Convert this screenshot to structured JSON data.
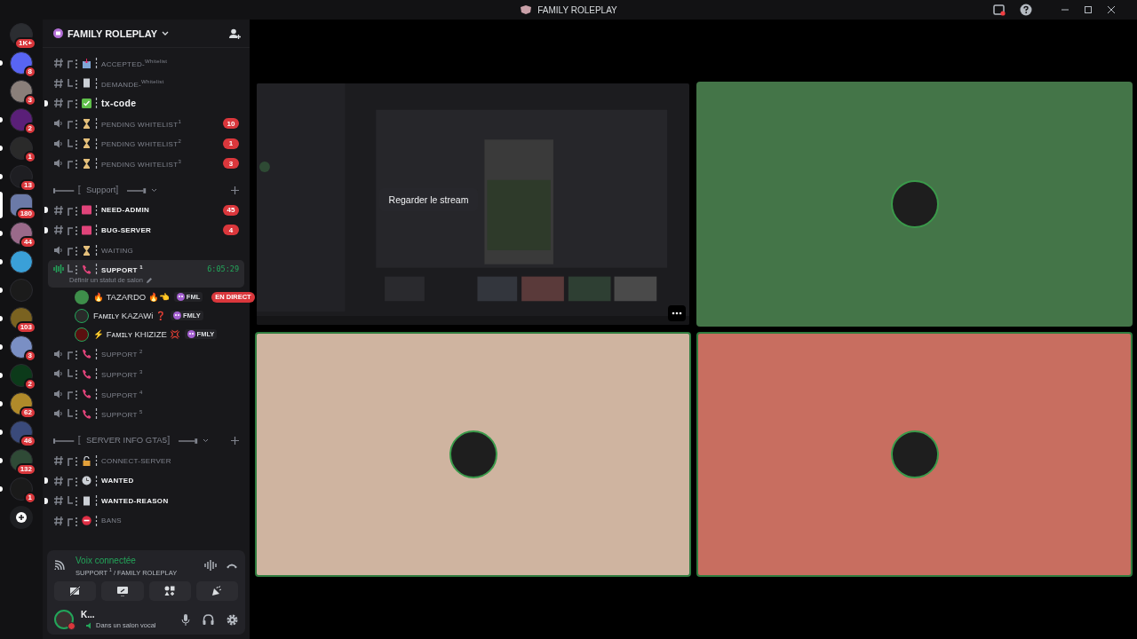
{
  "window": {
    "title": "FAMILY ROLEPLAY"
  },
  "servers": [
    {
      "badge": "1K+",
      "unread": false,
      "selected": false,
      "color": "#2b2d31"
    },
    {
      "badge": "8",
      "unread": true,
      "selected": false,
      "color": "#5865f2"
    },
    {
      "badge": "3",
      "unread": false,
      "selected": false,
      "color": "#8a7f7a"
    },
    {
      "badge": "2",
      "unread": true,
      "selected": false,
      "color": "#5a1f78"
    },
    {
      "badge": "1",
      "unread": true,
      "selected": false,
      "color": "#2a2a2a"
    },
    {
      "badge": "13",
      "unread": true,
      "selected": false,
      "color": "#1e1e22"
    },
    {
      "badge": "180",
      "unread": false,
      "selected": true,
      "color": "#6b7aa8"
    },
    {
      "badge": "44",
      "unread": true,
      "selected": false,
      "color": "#9a6a8a"
    },
    {
      "unread": true,
      "selected": false,
      "color": "#3aa0d8"
    },
    {
      "unread": true,
      "selected": false,
      "color": "#1b1b1b"
    },
    {
      "badge": "103",
      "unread": true,
      "selected": false,
      "color": "#7a6220"
    },
    {
      "badge": "3",
      "unread": true,
      "selected": false,
      "color": "#7a8fc4"
    },
    {
      "badge": "2",
      "unread": true,
      "selected": false,
      "color": "#0c3a1a"
    },
    {
      "badge": "62",
      "unread": true,
      "selected": false,
      "color": "#b08a2a"
    },
    {
      "badge": "46",
      "unread": true,
      "selected": false,
      "color": "#3a4a7a"
    },
    {
      "badge": "132",
      "unread": true,
      "selected": false,
      "color": "#2f4a36"
    },
    {
      "badge": "1",
      "unread": true,
      "selected": false,
      "color": "#1a1a1a"
    }
  ],
  "guild": {
    "name": "FAMILY ROLEPLAY"
  },
  "channels": [
    {
      "kind": "text",
      "corner": {
        "kind": "top"
      },
      "emoji": {
        "kind": "inbox"
      },
      "name": "ACCEPTED-$^{Whitelist}$",
      "unread": false,
      "selected": false
    },
    {
      "kind": "text",
      "corner": {
        "kind": "bottom"
      },
      "emoji": {
        "kind": "page"
      },
      "name": "DEMANDE-$^{Whitelist}$",
      "unread": false,
      "selected": false
    },
    {
      "kind": "text",
      "corner": {
        "kind": "top"
      },
      "emoji": {
        "kind": "check"
      },
      "name": "tx-code",
      "unread": true,
      "selected": false
    },
    {
      "kind": "voice",
      "corner": {
        "kind": "top"
      },
      "emoji": {
        "kind": "hourglass"
      },
      "name": "PENDING WHITELIST$^{1}$",
      "badge": "10",
      "unread": false,
      "selected": false
    },
    {
      "kind": "voice",
      "corner": {
        "kind": "bottom"
      },
      "emoji": {
        "kind": "hourglass"
      },
      "name": "PENDING WHITELIST$^{2}$",
      "badge": "1",
      "unread": false,
      "selected": false
    },
    {
      "kind": "voice",
      "corner": {
        "kind": "top"
      },
      "emoji": {
        "kind": "hourglass"
      },
      "name": "PENDING WHITELIST$^{3}$",
      "badge": "3",
      "unread": false,
      "selected": false
    },
    {
      "kind": "category",
      "name": "〚Support〛"
    },
    {
      "kind": "text",
      "corner": {
        "kind": "top"
      },
      "emoji": {
        "kind": "sos"
      },
      "name": "NEED-ADMIN",
      "badge": "45",
      "unread": true,
      "selected": false
    },
    {
      "kind": "text",
      "corner": {
        "kind": "top"
      },
      "emoji": {
        "kind": "sos"
      },
      "name": "BUG-SERVER",
      "badge": "4",
      "unread": true,
      "selected": false
    },
    {
      "kind": "voice",
      "corner": {
        "kind": "top"
      },
      "emoji": {
        "kind": "hourglass"
      },
      "name": "WAITING",
      "unread": false,
      "selected": false
    },
    {
      "kind": "voice",
      "corner": {
        "kind": "bottom"
      },
      "emoji": {
        "kind": "phone"
      },
      "name": "SUPPORT $^{1}$",
      "unread": false,
      "selected": true,
      "timer": "6:05:29",
      "status": "Définir un statut de salon",
      "members": [
        {
          "name": "🔥 TAZARDO 🔥👈",
          "tag": "FML",
          "live": "EN DIRECT",
          "speaking": false,
          "color": "#3e8e4a"
        },
        {
          "name": "Fᴀᴍɪʟʏ KAZAWi ❓",
          "tag": "FMLY",
          "speaking": true,
          "color": "#2a2a2a"
        },
        {
          "name": "⚡ Fᴀᴍɪʟʏ KHIZIZE 💢",
          "tag": "FMLY",
          "speaking": true,
          "color": "#5a1010"
        }
      ]
    },
    {
      "kind": "voice",
      "corner": {
        "kind": "top"
      },
      "emoji": {
        "kind": "phone"
      },
      "name": "SUPPORT $^{2}$",
      "unread": false,
      "selected": false
    },
    {
      "kind": "voice",
      "corner": {
        "kind": "bottom"
      },
      "emoji": {
        "kind": "phone"
      },
      "name": "SUPPORT $^{3}$",
      "unread": false,
      "selected": false
    },
    {
      "kind": "voice",
      "corner": {
        "kind": "top"
      },
      "emoji": {
        "kind": "phone"
      },
      "name": "SUPPORT $^{4}$",
      "unread": false,
      "selected": false
    },
    {
      "kind": "voice",
      "corner": {
        "kind": "bottom"
      },
      "emoji": {
        "kind": "phone"
      },
      "name": "SUPPORT $^{5}$",
      "unread": false,
      "selected": false
    },
    {
      "kind": "category",
      "name": "〚SERVER INFO GTA5〛"
    },
    {
      "kind": "text",
      "corner": {
        "kind": "top"
      },
      "emoji": {
        "kind": "lock"
      },
      "name": "CONNECT-SERVER",
      "unread": false,
      "selected": false
    },
    {
      "kind": "text",
      "corner": {
        "kind": "top"
      },
      "emoji": {
        "kind": "clock"
      },
      "name": "WANTED",
      "unread": true,
      "selected": false
    },
    {
      "kind": "text",
      "corner": {
        "kind": "bottom"
      },
      "emoji": {
        "kind": "page"
      },
      "name": "WANTED-REASON",
      "unread": true,
      "selected": false
    },
    {
      "kind": "text",
      "corner": {
        "kind": "top"
      },
      "emoji": {
        "kind": "no-entry"
      },
      "name": "BANS",
      "unread": false,
      "selected": false
    }
  ],
  "voice_panel": {
    "status": "Voix connectée",
    "location": "SUPPORT $^{1}$ / FAMILY ROLEPLAY"
  },
  "user": {
    "name": "K...",
    "status": "Dans un salon vocal"
  },
  "tiles": [
    {
      "kind": "stream",
      "button": "Regarder le stream",
      "speaking": false
    },
    {
      "kind": "avatar",
      "color": "#447548",
      "speaking": false
    },
    {
      "kind": "avatar",
      "color": "#cfb4a0",
      "speaking": true
    },
    {
      "kind": "avatar",
      "color": "#c86e60",
      "speaking": true
    }
  ]
}
